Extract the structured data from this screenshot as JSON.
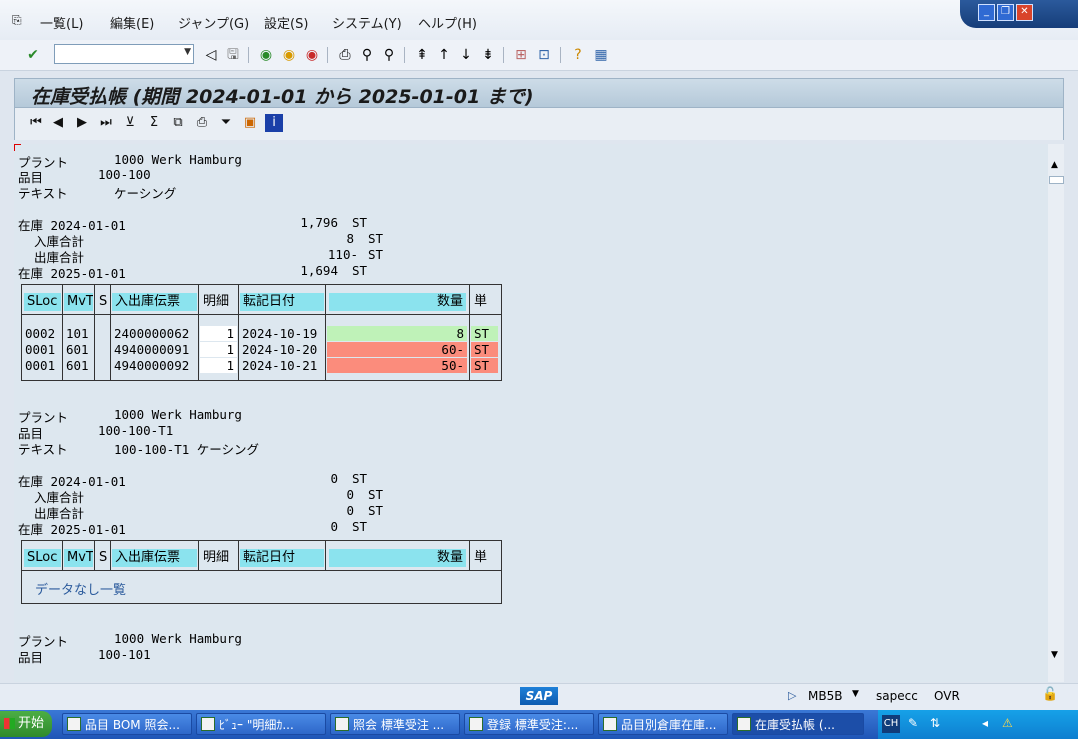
{
  "menu": {
    "items": [
      "一覧(L)",
      "編集(E)",
      "ジャンプ(G)",
      "設定(S)",
      "システム(Y)",
      "ヘルプ(H)"
    ]
  },
  "title": "在庫受払帳 (期間 2024-01-01 から 2025-01-01 まで)",
  "columns": {
    "sloc": "SLoc",
    "mvt": "MvT",
    "s": "S",
    "doc": "入出庫伝票",
    "item": "明細",
    "date": "転記日付",
    "qty": "数量",
    "unit": "単"
  },
  "sections": [
    {
      "plant_label": "プラント",
      "plant": "1000 Werk Hamburg",
      "material_label": "品目",
      "material": "100-100",
      "text_label": "テキスト",
      "text": "ケーシング",
      "stock_start_label": "在庫 2024-01-01",
      "stock_start": "1,796",
      "stock_start_unit": "ST",
      "receipts_label": "入庫合計",
      "receipts": "8",
      "receipts_unit": "ST",
      "issues_label": "出庫合計",
      "issues": "110-",
      "issues_unit": "ST",
      "stock_end_label": "在庫 2025-01-01",
      "stock_end": "1,694",
      "stock_end_unit": "ST",
      "rows": [
        {
          "sloc": "0002",
          "mvt": "101",
          "s": "",
          "doc": "2400000062",
          "item": "1",
          "date": "2024-10-19",
          "qty": "8",
          "unit": "ST"
        },
        {
          "sloc": "0001",
          "mvt": "601",
          "s": "",
          "doc": "4940000091",
          "item": "1",
          "date": "2024-10-20",
          "qty": "60-",
          "unit": "ST"
        },
        {
          "sloc": "0001",
          "mvt": "601",
          "s": "",
          "doc": "4940000092",
          "item": "1",
          "date": "2024-10-21",
          "qty": "50-",
          "unit": "ST"
        }
      ]
    },
    {
      "plant_label": "プラント",
      "plant": "1000 Werk Hamburg",
      "material_label": "品目",
      "material": "100-100-T1",
      "text_label": "テキスト",
      "text": "100-100-T1 ケーシング",
      "stock_start_label": "在庫 2024-01-01",
      "stock_start": "0",
      "stock_start_unit": "ST",
      "receipts_label": "入庫合計",
      "receipts": "0",
      "receipts_unit": "ST",
      "issues_label": "出庫合計",
      "issues": "0",
      "issues_unit": "ST",
      "stock_end_label": "在庫 2025-01-01",
      "stock_end": "0",
      "stock_end_unit": "ST",
      "empty_text": "データなし一覧"
    },
    {
      "plant_label": "プラント",
      "plant": "1000 Werk Hamburg",
      "material_label": "品目",
      "material": "100-101"
    }
  ],
  "status": {
    "transaction": "MB5B",
    "server": "sapecc",
    "mode": "OVR"
  },
  "taskbar": {
    "start": "开始",
    "tasks": [
      "品目 BOM 照会...",
      "ﾋﾞｭｰ \"明細ｶ...",
      "照会 標準受注 ...",
      "登録 標準受注:...",
      "品目別倉庫在庫...",
      "在庫受払帳 (..."
    ],
    "tray_text": "CH"
  },
  "colors": {
    "header_cyan": "#8be3ee",
    "positive_qty": "#bff2b8",
    "negative_qty": "#fb8c7c"
  }
}
